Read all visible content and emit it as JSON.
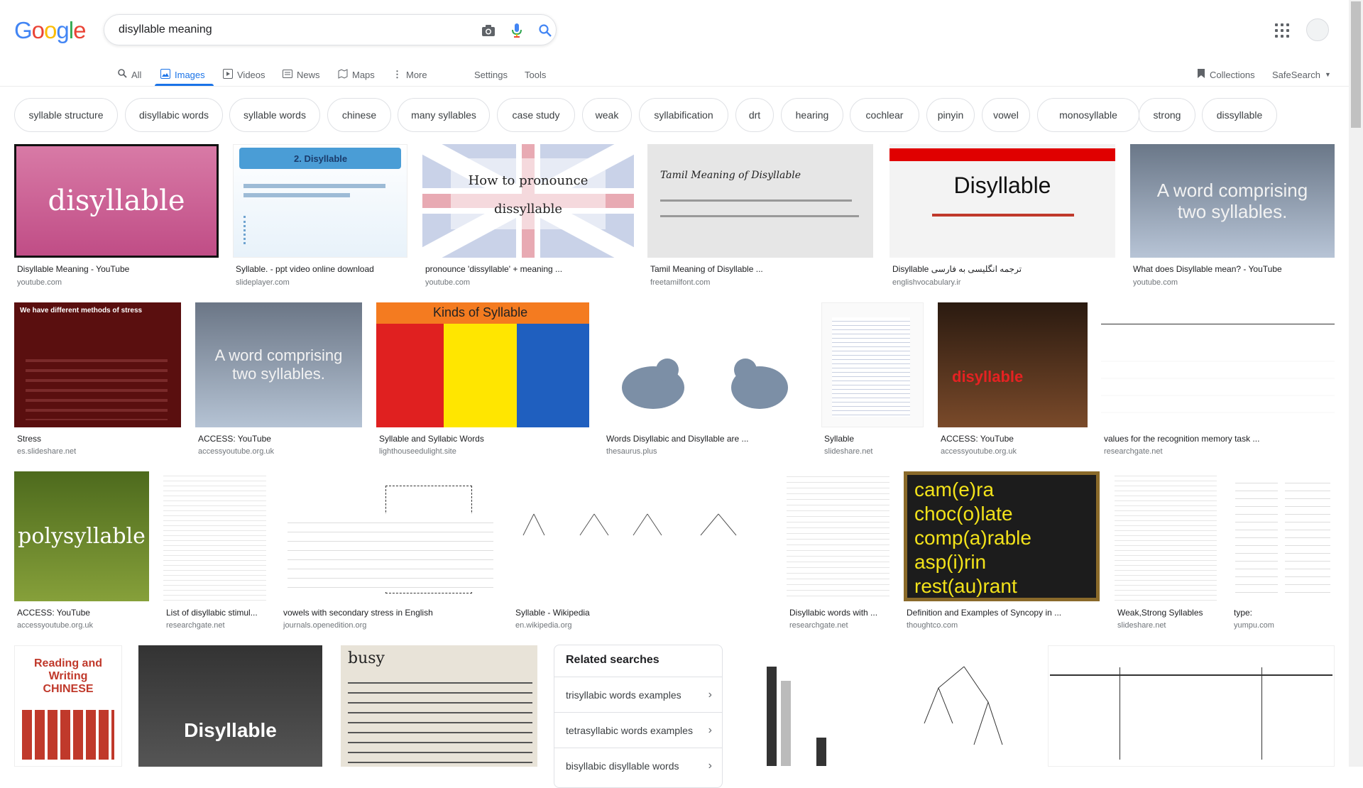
{
  "logo": [
    "G",
    "o",
    "o",
    "g",
    "l",
    "e"
  ],
  "search": {
    "query": "disyllable meaning"
  },
  "tabs": [
    {
      "label": "All",
      "icon": "search-icon"
    },
    {
      "label": "Images",
      "icon": "image-icon"
    },
    {
      "label": "Videos",
      "icon": "play-icon"
    },
    {
      "label": "News",
      "icon": "news-icon"
    },
    {
      "label": "Maps",
      "icon": "map-icon"
    },
    {
      "label": "More",
      "icon": "more-vert-icon"
    },
    {
      "label": "Settings"
    },
    {
      "label": "Tools"
    }
  ],
  "header_right": {
    "collections": "Collections",
    "safesearch": "SafeSearch"
  },
  "chips": [
    "syllable structure",
    "disyllabic words",
    "syllable words",
    "chinese",
    "many syllables",
    "case study",
    "weak",
    "syllabification",
    "drt",
    "hearing",
    "cochlear",
    "pinyin",
    "vowel",
    "monosyllable",
    "strong",
    "dissyllable"
  ],
  "results": [
    {
      "caption": "Disyllable Meaning - YouTube",
      "source": "youtube.com",
      "thumb_text": "disyllable"
    },
    {
      "caption": "Syllable. - ppt video online download",
      "source": "slideplayer.com",
      "thumb_text": "2. Disyllable"
    },
    {
      "caption": "pronounce 'dissyllable' + meaning ...",
      "source": "youtube.com",
      "thumb_text": "How to pronounce dissyllable"
    },
    {
      "caption": "Tamil Meaning of Disyllable ...",
      "source": "freetamilfont.com",
      "thumb_text": "Tamil Meaning of Disyllable"
    },
    {
      "caption": "Disyllable ترجمه انگلیسی به فارسی",
      "source": "englishvocabulary.ir",
      "thumb_text": "Disyllable"
    },
    {
      "caption": "What does Disyllable mean? - YouTube",
      "source": "youtube.com",
      "thumb_text": "A word comprising two syllables."
    },
    {
      "caption": "Stress",
      "source": "es.slideshare.net",
      "thumb_text": "We have different methods of stress"
    },
    {
      "caption": "ACCESS: YouTube",
      "source": "accessyoutube.org.uk",
      "thumb_text": "A word comprising two syllables."
    },
    {
      "caption": "Syllable and Syllabic Words",
      "source": "lighthouseedulight.site",
      "thumb_text": "Kinds of Syllable"
    },
    {
      "caption": "Words Disyllabic and Disyllable are ...",
      "source": "thesaurus.plus",
      "thumb_text": ""
    },
    {
      "caption": "Syllable",
      "source": "slideshare.net",
      "thumb_text": ""
    },
    {
      "caption": "ACCESS: YouTube",
      "source": "accessyoutube.org.uk",
      "thumb_text": "disyllable"
    },
    {
      "caption": "values for the recognition memory task ...",
      "source": "researchgate.net",
      "thumb_text": ""
    },
    {
      "caption": "ACCESS: YouTube",
      "source": "accessyoutube.org.uk",
      "thumb_text": "polysyllable"
    },
    {
      "caption": "List of disyllabic stimul...",
      "source": "researchgate.net",
      "thumb_text": ""
    },
    {
      "caption": "vowels with secondary stress in English",
      "source": "journals.openedition.org",
      "thumb_text": ""
    },
    {
      "caption": "Syllable - Wikipedia",
      "source": "en.wikipedia.org",
      "thumb_text": ""
    },
    {
      "caption": "Disyllabic words with ...",
      "source": "researchgate.net",
      "thumb_text": ""
    },
    {
      "caption": "Definition and Examples of Syncopy in ...",
      "source": "thoughtco.com",
      "thumb_text": "cam(e)ra choc(o)late comp(a)rable asp(i)rin rest(au)rant"
    },
    {
      "caption": "Weak,Strong Syllables",
      "source": "slideshare.net",
      "thumb_text": ""
    },
    {
      "caption": "type:",
      "source": "yumpu.com",
      "thumb_text": ""
    }
  ],
  "row4": [
    {
      "thumb_text": "Reading and Writing CHINESE"
    },
    {
      "thumb_text": "Disyllable"
    },
    {
      "thumb_text": "busy"
    },
    {
      "thumb_text": ""
    },
    {
      "thumb_text": ""
    },
    {
      "thumb_text": ""
    }
  ],
  "related": {
    "title": "Related searches",
    "items": [
      "trisyllabic words examples",
      "tetrasyllabic words examples",
      "bisyllabic disyllable words"
    ]
  },
  "colors": {
    "accent": "#1a73e8",
    "muted": "#70757a"
  }
}
